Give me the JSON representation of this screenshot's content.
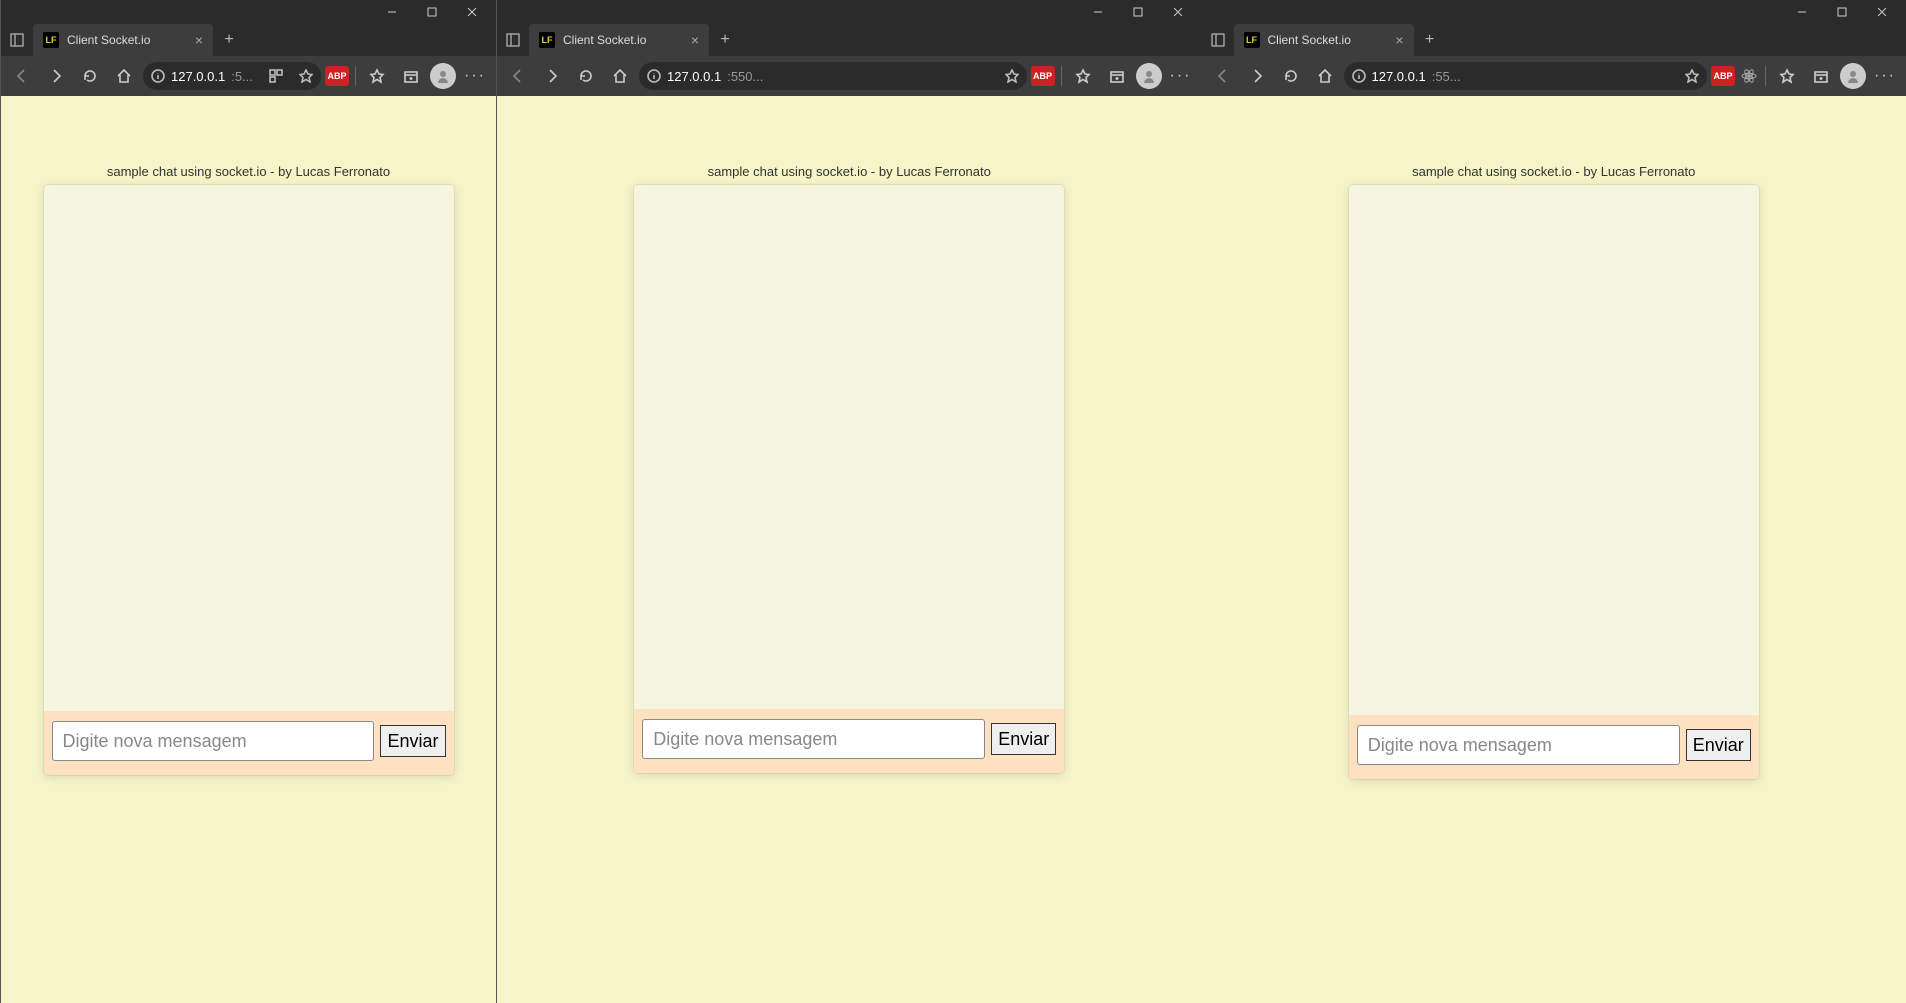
{
  "windows": [
    {
      "tab": {
        "title": "Client Socket.io",
        "favicon_text": "LF"
      },
      "address": {
        "host": "127.0.0.1",
        "port_suffix": ":5..."
      },
      "extensions": {
        "abp_label": "ABP",
        "show_react": false,
        "show_extra_star": true
      },
      "page": {
        "heading": "sample chat using socket.io - by Lucas Ferronato",
        "input_placeholder": "Digite nova mensagem",
        "send_label": "Enviar"
      }
    },
    {
      "tab": {
        "title": "Client Socket.io",
        "favicon_text": "LF"
      },
      "address": {
        "host": "127.0.0.1",
        "port_suffix": ":550..."
      },
      "extensions": {
        "abp_label": "ABP",
        "show_react": false,
        "show_extra_star": false
      },
      "page": {
        "heading": "sample chat using socket.io - by Lucas Ferronato",
        "input_placeholder": "Digite nova mensagem",
        "send_label": "Enviar"
      }
    },
    {
      "tab": {
        "title": "Client Socket.io",
        "favicon_text": "LF"
      },
      "address": {
        "host": "127.0.0.1",
        "port_suffix": ":55..."
      },
      "extensions": {
        "abp_label": "ABP",
        "show_react": true,
        "show_extra_star": false
      },
      "page": {
        "heading": "sample chat using socket.io - by Lucas Ferronato",
        "input_placeholder": "Digite nova mensagem",
        "send_label": "Enviar"
      }
    }
  ]
}
